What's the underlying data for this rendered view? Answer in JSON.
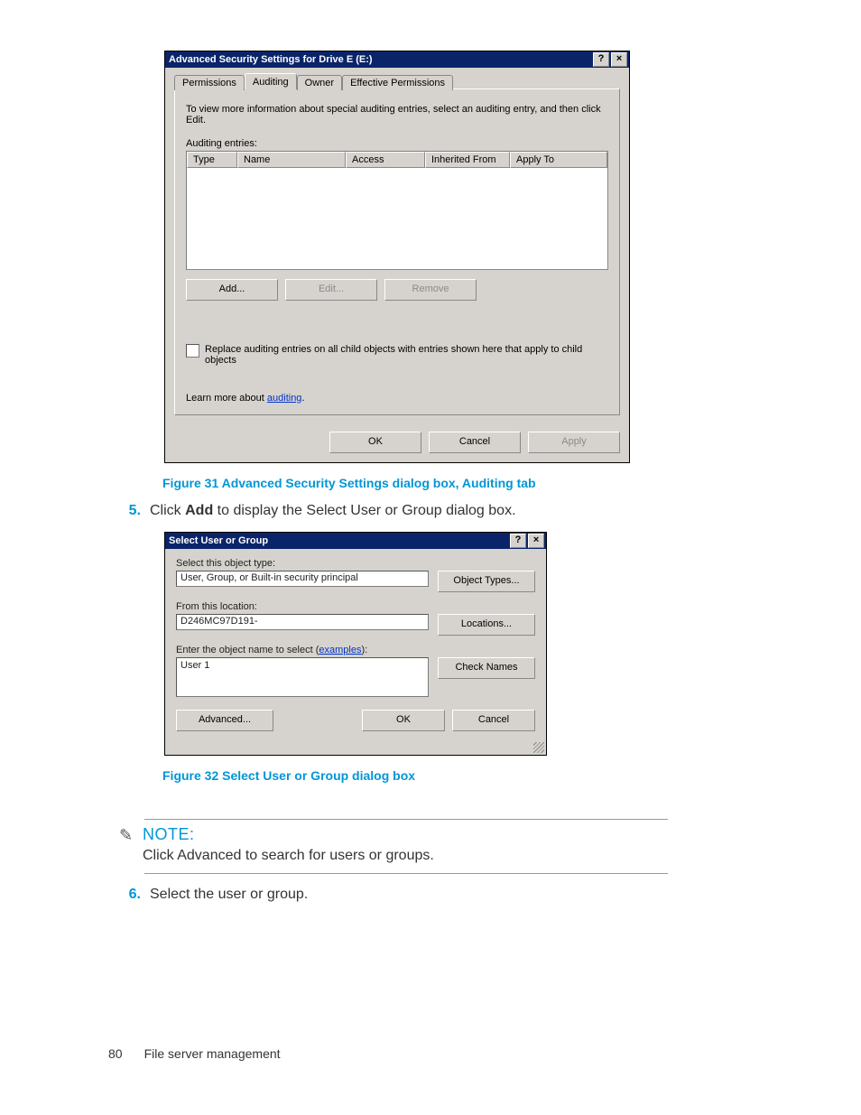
{
  "dialog1": {
    "title": "Advanced Security Settings for Drive E (E:)",
    "help_button": "?",
    "close_button": "×",
    "tabs": [
      "Permissions",
      "Auditing",
      "Owner",
      "Effective Permissions"
    ],
    "active_tab_index": 1,
    "instruction": "To view more information about special auditing entries, select an auditing entry, and then click Edit.",
    "entries_label": "Auditing entries:",
    "columns": [
      "Type",
      "Name",
      "Access",
      "Inherited From",
      "Apply To"
    ],
    "buttons": {
      "add": "Add...",
      "edit": "Edit...",
      "remove": "Remove"
    },
    "replace_text": "Replace auditing entries on all child objects with entries shown here that apply to child objects",
    "learn_prefix": "Learn more about ",
    "learn_link": "auditing",
    "footer": {
      "ok": "OK",
      "cancel": "Cancel",
      "apply": "Apply"
    }
  },
  "figure31": "Figure 31 Advanced Security Settings dialog box, Auditing tab",
  "step5": {
    "num": "5.",
    "pre": "Click ",
    "bold": "Add",
    "post": " to display the Select User or Group dialog box."
  },
  "dialog2": {
    "title": "Select User or Group",
    "help_button": "?",
    "close_button": "×",
    "object_type_label": "Select this object type:",
    "object_type_value": "User, Group, or Built-in security principal",
    "object_types_btn": "Object Types...",
    "location_label": "From this location:",
    "location_value": "D246MC97D191-",
    "locations_btn": "Locations...",
    "enter_label_pre": "Enter the object name to select (",
    "examples_link": "examples",
    "enter_label_post": "):",
    "enter_value": "User 1",
    "check_names_btn": "Check Names",
    "advanced_btn": "Advanced...",
    "ok_btn": "OK",
    "cancel_btn": "Cancel"
  },
  "figure32": "Figure 32 Select User or Group dialog box",
  "note": {
    "label": "NOTE:",
    "body": "Click Advanced to search for users or groups."
  },
  "step6": {
    "num": "6.",
    "body": "Select the user or group."
  },
  "footer": {
    "page": "80",
    "section": "File server management"
  }
}
